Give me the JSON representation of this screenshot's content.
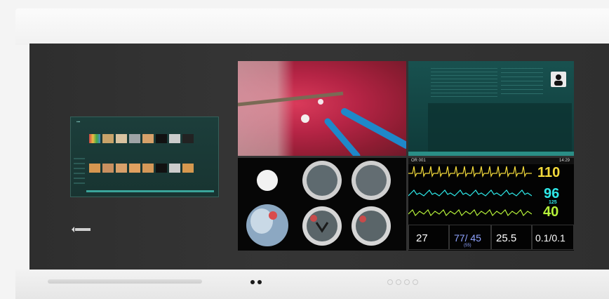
{
  "vitals": {
    "header_left": "OR 001",
    "header_right": "14:29",
    "hr": "110",
    "spo2": "96",
    "spo2_sub": "125",
    "resp": "40",
    "bottom": [
      {
        "value": "27",
        "color": "#ffffff"
      },
      {
        "value": "77/ 45",
        "color": "#8fa3ff"
      },
      {
        "value": "25.5",
        "color": "#ffffff"
      },
      {
        "value": "0.1/0.1",
        "color": "#ffffff"
      }
    ],
    "bp_sub": "(55)",
    "colors": {
      "hr": "#f2d93b",
      "spo2": "#2ee8e8",
      "resp": "#b6f23a"
    }
  },
  "icons": {
    "logo": "eizo-logo-icon",
    "avatar": "user-avatar-icon"
  }
}
